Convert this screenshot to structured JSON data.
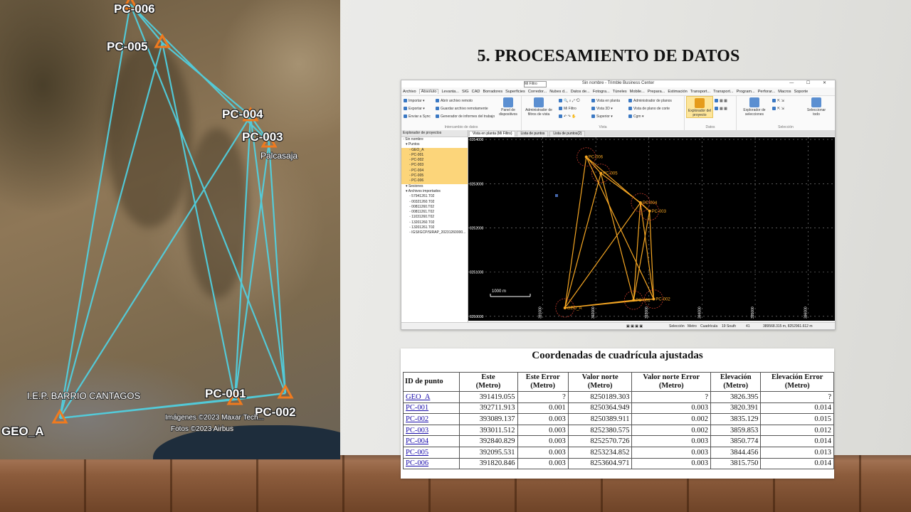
{
  "slide": {
    "title": "5. PROCESAMIENTO DE DATOS"
  },
  "photo": {
    "point_labels": [
      "PC-006",
      "PC-005",
      "PC-004",
      "PC-003",
      "PC-001",
      "PC-002",
      "GEO_A"
    ],
    "poi_labels": [
      "Palcasaja",
      "I.E.P. BARRIO CANTAGOS",
      "Imágenes ©2023 Maxar Tech...",
      "Fotos ©2023 Airbus"
    ],
    "line_color": "#4fd4e6",
    "marker_color": "#f07a1e"
  },
  "tbc": {
    "window_title": "Sin nombre - Trimble Business Center",
    "filter_value": "Mi Filtro",
    "window_buttons": "— ☐ ✕",
    "menu": [
      "Archivo",
      "Absoluto",
      "Levanta...",
      "SIG",
      "CAD",
      "Borradores",
      "Superficies",
      "Corredor...",
      "Nubes d...",
      "Datos de...",
      "Fotogra...",
      "Túneles",
      "Mobile...",
      "Prepara...",
      "Estimación",
      "Transport...",
      "Transport...",
      "Program...",
      "Perforar...",
      "Macros",
      "Soporte"
    ],
    "ribbon": {
      "import": "Importar ▾",
      "export": "Exportar ▾",
      "send_sync": "Enviar a Sync",
      "open_remote": "Abrir archivo remoto",
      "save_remote": "Guardar archivo remotamente",
      "report_gen": "Generador de informes del trabajo",
      "devices_panel": "Panel de dispositivos",
      "group_exchange": "Intercambio de datos",
      "view_filter_admin": "Administrador de filtros de vista",
      "my_filter": "Mi Filtro",
      "plan_view": "Vista en planta",
      "view3d": "Vista 3D ▾",
      "surface": "Superior ▾",
      "plane_admin": "Administrador de planos",
      "cut_plane_view": "Vista de plano de corte",
      "cgm": "Cgm ▾",
      "group_view": "Vista",
      "project_explorer": "Explorador del proyecto",
      "group_data": "Datos",
      "selection_explorer": "Explorador de selecciones",
      "select_all": "Seleccionar todo",
      "group_selection": "Selección"
    },
    "explorer": {
      "header": "Explorador de proyectos",
      "items": [
        "Sin nombre",
        "Puntos",
        "GEO_A",
        "PC-001",
        "PC-002",
        "PC-003",
        "PC-004",
        "PC-005",
        "PC-006",
        "Sesiones",
        "Archivos importados",
        "57941261.T02",
        "00321260.T02",
        "00811260.T02",
        "00811261.T02",
        "11031260.T02",
        "13201260.T02",
        "13201261.T02",
        "IGS/IGCP/SIRAP_20231260000..."
      ]
    },
    "view_tabs": [
      "Vista en planta (Mi Filtro)",
      "Lista de puntos",
      "Lista de puntos(2)"
    ],
    "plot": {
      "y_ticks": [
        "8254000",
        "8253000",
        "8252000",
        "8251000",
        "8250000"
      ],
      "x_ticks": [
        "391000",
        "392000",
        "393000",
        "394000",
        "395000",
        "396000"
      ],
      "scale_label": "1000 m",
      "points": [
        {
          "name": "GEO_A",
          "x": 391419.055,
          "y": 8250189.303
        },
        {
          "name": "PC-001",
          "x": 392711.913,
          "y": 8250364.949
        },
        {
          "name": "PC-002",
          "x": 393089.137,
          "y": 8250389.911
        },
        {
          "name": "PC-003",
          "x": 393011.512,
          "y": 8252380.575
        },
        {
          "name": "PC-004",
          "x": 392840.829,
          "y": 8252570.726
        },
        {
          "name": "PC-005",
          "x": 392095.531,
          "y": 8253234.852
        },
        {
          "name": "PC-006",
          "x": 391820.846,
          "y": 8253604.971
        }
      ],
      "x_range": [
        389600,
        396500
      ],
      "y_range": [
        8249900,
        8254050
      ],
      "line_color": "#f5a623"
    },
    "status": {
      "selection": "Selección",
      "unit": "Metro",
      "grid": "Cuadrícula",
      "zone": "19 South",
      "count": "41",
      "coords": "389568.315 m, 8252961.612 m"
    }
  },
  "coords_table": {
    "title": "Coordenadas de cuadrícula ajustadas",
    "headers": [
      "ID de punto",
      "Este\n(Metro)",
      "Este Error\n(Metro)",
      "Valor norte\n(Metro)",
      "Valor norte Error\n(Metro)",
      "Elevación\n(Metro)",
      "Elevación Error\n(Metro)"
    ],
    "rows": [
      [
        "GEO_A",
        "391419.055",
        "?",
        "8250189.303",
        "?",
        "3826.395",
        "?"
      ],
      [
        "PC-001",
        "392711.913",
        "0.001",
        "8250364.949",
        "0.003",
        "3820.391",
        "0.014"
      ],
      [
        "PC-002",
        "393089.137",
        "0.003",
        "8250389.911",
        "0.002",
        "3835.129",
        "0.015"
      ],
      [
        "PC-003",
        "393011.512",
        "0.003",
        "8252380.575",
        "0.002",
        "3859.853",
        "0.012"
      ],
      [
        "PC-004",
        "392840.829",
        "0.003",
        "8252570.726",
        "0.003",
        "3850.774",
        "0.014"
      ],
      [
        "PC-005",
        "392095.531",
        "0.003",
        "8253234.852",
        "0.003",
        "3844.456",
        "0.013"
      ],
      [
        "PC-006",
        "391820.846",
        "0.003",
        "8253604.971",
        "0.003",
        "3815.750",
        "0.014"
      ]
    ]
  }
}
